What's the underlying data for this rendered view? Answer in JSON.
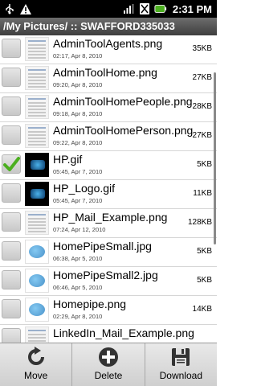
{
  "status_bar": {
    "time": "2:31 PM",
    "icons": [
      "usb-icon",
      "warning-icon",
      "signal-icon",
      "no-sim-icon",
      "battery-icon"
    ]
  },
  "title": "/My Pictures/ :: SWAFFORD335033",
  "files": [
    {
      "name": "AdminToolAgents.png",
      "date": "02:17, Apr 8, 2010",
      "size": "35KB",
      "checked": false,
      "thumb": "doc"
    },
    {
      "name": "AdminToolHome.png",
      "date": "09:20, Apr 8, 2010",
      "size": "27KB",
      "checked": false,
      "thumb": "doc"
    },
    {
      "name": "AdminToolHomePeople.png",
      "date": "09:18, Apr 8, 2010",
      "size": "28KB",
      "checked": false,
      "thumb": "doc"
    },
    {
      "name": "AdminToolHomePerson.png",
      "date": "09:22, Apr 8, 2010",
      "size": "27KB",
      "checked": false,
      "thumb": "doc"
    },
    {
      "name": "HP.gif",
      "date": "05:45, Apr 7, 2010",
      "size": "5KB",
      "checked": true,
      "thumb": "dark"
    },
    {
      "name": "HP_Logo.gif",
      "date": "05:45, Apr 7, 2010",
      "size": "11KB",
      "checked": false,
      "thumb": "dark"
    },
    {
      "name": "HP_Mail_Example.png",
      "date": "07:24, Apr 12, 2010",
      "size": "128KB",
      "checked": false,
      "thumb": "doc"
    },
    {
      "name": "HomePipeSmall.jpg",
      "date": "06:38, Apr 5, 2010",
      "size": "5KB",
      "checked": false,
      "thumb": "logo"
    },
    {
      "name": "HomePipeSmall2.jpg",
      "date": "06:46, Apr 5, 2010",
      "size": "5KB",
      "checked": false,
      "thumb": "logo"
    },
    {
      "name": "Homepipe.png",
      "date": "02:29, Apr 8, 2010",
      "size": "14KB",
      "checked": false,
      "thumb": "logo"
    },
    {
      "name": "LinkedIn_Mail_Example.png",
      "date": "",
      "size": "",
      "checked": false,
      "thumb": "doc"
    }
  ],
  "menu": {
    "move_label": "Move",
    "delete_label": "Delete",
    "download_label": "Download"
  },
  "colors": {
    "check": "#4caf20",
    "titlebar": "#555555"
  }
}
